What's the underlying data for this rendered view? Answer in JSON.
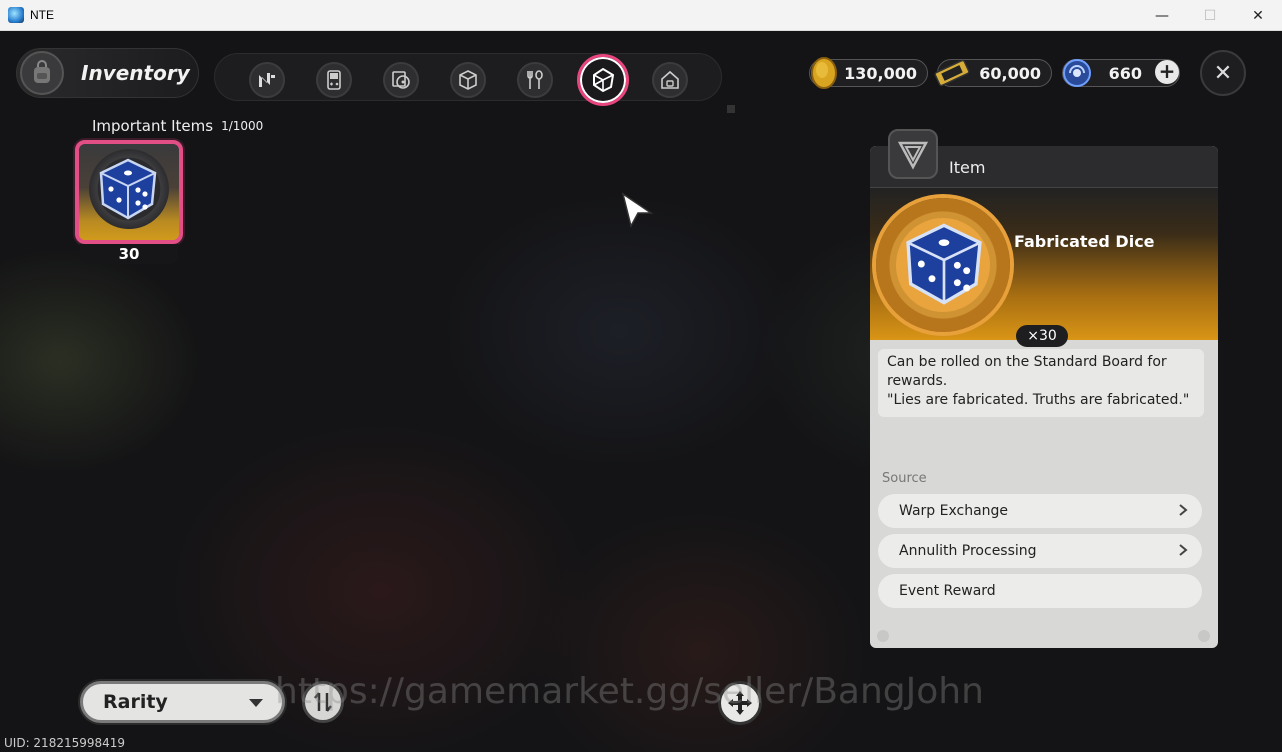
{
  "window": {
    "title": "NTE",
    "minimize": "—",
    "maximize": "☐",
    "close": "✕"
  },
  "header": {
    "title": "Inventory"
  },
  "tabs": [
    {
      "name": "tab-n",
      "icon": "n-logo-icon"
    },
    {
      "name": "tab-gameboy",
      "icon": "handheld-console-icon"
    },
    {
      "name": "tab-materials",
      "icon": "disc-box-icon"
    },
    {
      "name": "tab-boxes",
      "icon": "cube-icon"
    },
    {
      "name": "tab-food",
      "icon": "fork-spoon-icon"
    },
    {
      "name": "tab-important",
      "icon": "crystal-icon",
      "active": true
    },
    {
      "name": "tab-home",
      "icon": "house-icon"
    }
  ],
  "currencies": [
    {
      "name": "gold-coins",
      "icon": "coin-icon",
      "value": "130,000"
    },
    {
      "name": "tickets",
      "icon": "ticket-icon",
      "value": "60,000"
    },
    {
      "name": "crystals",
      "icon": "crystal-orb-icon",
      "value": "660"
    }
  ],
  "plus": "+",
  "close": "✕",
  "section": {
    "label": "Important Items",
    "count": "1/1000"
  },
  "items": [
    {
      "name": "Fabricated Dice",
      "count": "30"
    }
  ],
  "panel": {
    "category": "Item",
    "item_name": "Fabricated Dice",
    "quantity": "×30",
    "description_line1": "Can be rolled on the Standard Board for rewards.",
    "description_line2": "\"Lies are fabricated. Truths are fabricated.\"",
    "source_label": "Source",
    "sources": [
      {
        "label": "Warp Exchange",
        "has_arrow": true
      },
      {
        "label": "Annulith Processing",
        "has_arrow": true
      },
      {
        "label": "Event Reward",
        "has_arrow": false
      }
    ]
  },
  "footer": {
    "rarity_label": "Rarity",
    "uid": "UID: 218215998419",
    "watermark": "https://gamemarket.gg/seller/BangJohn"
  },
  "colors": {
    "accent": "#e24f86",
    "gold": "#d99516",
    "panel": "#d8d8d6"
  }
}
